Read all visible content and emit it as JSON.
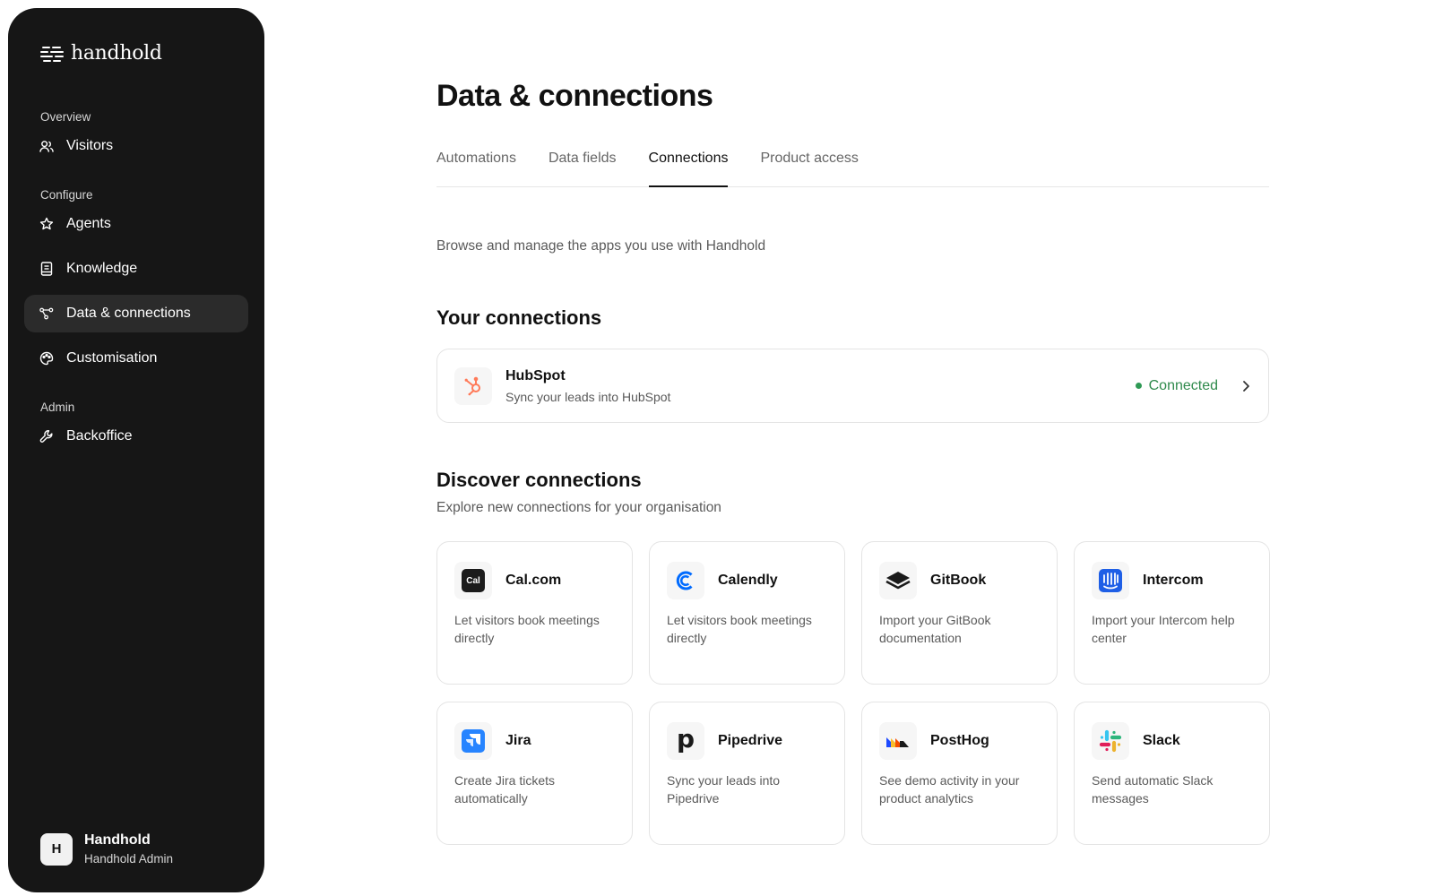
{
  "brand": {
    "name": "handhold"
  },
  "sidebar": {
    "sections": [
      {
        "label": "Overview"
      },
      {
        "label": "Configure"
      },
      {
        "label": "Admin"
      }
    ],
    "items": [
      {
        "label": "Visitors",
        "icon": "users-icon"
      },
      {
        "label": "Agents",
        "icon": "star-icon"
      },
      {
        "label": "Knowledge",
        "icon": "book-icon"
      },
      {
        "label": "Data & connections",
        "icon": "connections-icon",
        "active": true
      },
      {
        "label": "Customisation",
        "icon": "palette-icon"
      },
      {
        "label": "Backoffice",
        "icon": "wrench-icon"
      }
    ],
    "user": {
      "initial": "H",
      "name": "Handhold",
      "role": "Handhold Admin"
    }
  },
  "main": {
    "title": "Data & connections",
    "tabs": [
      {
        "label": "Automations"
      },
      {
        "label": "Data fields"
      },
      {
        "label": "Connections",
        "active": true
      },
      {
        "label": "Product access"
      }
    ],
    "intro": "Browse and manage the apps you use with Handhold",
    "your_connections": {
      "heading": "Your connections",
      "items": [
        {
          "name": "HubSpot",
          "description": "Sync your leads into HubSpot",
          "status": "Connected",
          "icon": "hubspot-icon"
        }
      ]
    },
    "discover": {
      "heading": "Discover connections",
      "subtitle": "Explore new connections for your organisation",
      "items": [
        {
          "name": "Cal.com",
          "description": "Let visitors book meetings directly",
          "icon": "calcom-icon",
          "logo_text": "Cal"
        },
        {
          "name": "Calendly",
          "description": "Let visitors book meetings directly",
          "icon": "calendly-icon"
        },
        {
          "name": "GitBook",
          "description": "Import your GitBook documentation",
          "icon": "gitbook-icon"
        },
        {
          "name": "Intercom",
          "description": "Import your Intercom help center",
          "icon": "intercom-icon"
        },
        {
          "name": "Jira",
          "description": "Create Jira tickets automatically",
          "icon": "jira-icon"
        },
        {
          "name": "Pipedrive",
          "description": "Sync your leads into Pipedrive",
          "icon": "pipedrive-icon",
          "logo_text": "p"
        },
        {
          "name": "PostHog",
          "description": "See demo activity in your product analytics",
          "icon": "posthog-icon"
        },
        {
          "name": "Slack",
          "description": "Send automatic Slack messages",
          "icon": "slack-icon"
        }
      ]
    }
  },
  "colors": {
    "sidebar_bg": "#161616",
    "active_nav_bg": "#2b2b2b",
    "connected": "#2f8a4c",
    "hubspot": "#ff7a59",
    "calendly": "#006bff",
    "intercom": "#1f5fe6",
    "jira": "#2684ff"
  }
}
